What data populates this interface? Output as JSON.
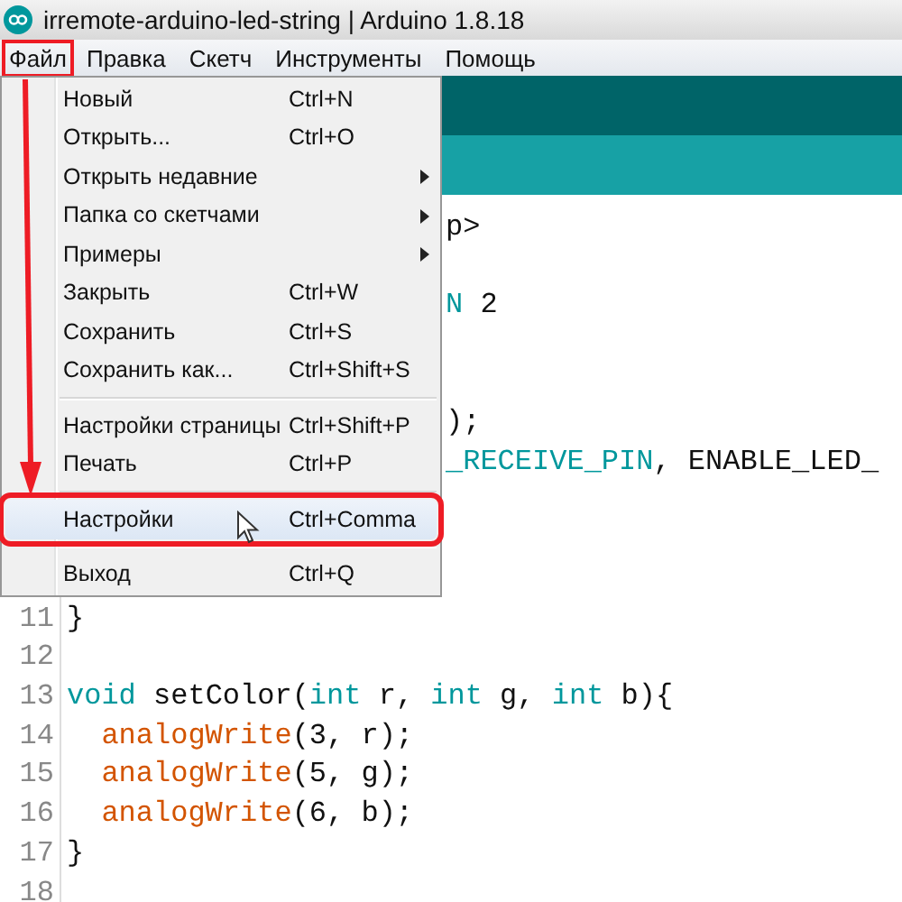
{
  "window": {
    "title": "irremote-arduino-led-string | Arduino 1.8.18"
  },
  "menubar": [
    {
      "label": "Файл",
      "selected": true
    },
    {
      "label": "Правка",
      "selected": false
    },
    {
      "label": "Скетч",
      "selected": false
    },
    {
      "label": "Инструменты",
      "selected": false
    },
    {
      "label": "Помощь",
      "selected": false
    }
  ],
  "file_menu": [
    {
      "kind": "item",
      "label": "Новый",
      "shortcut": "Ctrl+N",
      "submenu": false,
      "selected": false
    },
    {
      "kind": "item",
      "label": "Открыть...",
      "shortcut": "Ctrl+O",
      "submenu": false,
      "selected": false
    },
    {
      "kind": "item",
      "label": "Открыть недавние",
      "submenu": true,
      "selected": false
    },
    {
      "kind": "item",
      "label": "Папка со скетчами",
      "submenu": true,
      "selected": false
    },
    {
      "kind": "item",
      "label": "Примеры",
      "submenu": true,
      "selected": false
    },
    {
      "kind": "item",
      "label": "Закрыть",
      "shortcut": "Ctrl+W",
      "submenu": false,
      "selected": false
    },
    {
      "kind": "item",
      "label": "Сохранить",
      "shortcut": "Ctrl+S",
      "submenu": false,
      "selected": false
    },
    {
      "kind": "item",
      "label": "Сохранить как...",
      "shortcut": "Ctrl+Shift+S",
      "submenu": false,
      "selected": false
    },
    {
      "kind": "separator"
    },
    {
      "kind": "item",
      "label": "Настройки страницы",
      "shortcut": "Ctrl+Shift+P",
      "submenu": false,
      "selected": false
    },
    {
      "kind": "item",
      "label": "Печать",
      "shortcut": "Ctrl+P",
      "submenu": false,
      "selected": false
    },
    {
      "kind": "separator"
    },
    {
      "kind": "item",
      "label": "Настройки",
      "shortcut": "Ctrl+Comma",
      "submenu": false,
      "selected": true
    },
    {
      "kind": "separator"
    },
    {
      "kind": "item",
      "label": "Выход",
      "shortcut": "Ctrl+Q",
      "submenu": false,
      "selected": false
    }
  ],
  "editor": {
    "fragments_beside_menu": [
      {
        "segments": [
          {
            "kind": "plain",
            "text": "p>"
          }
        ]
      },
      {
        "segments": [
          {
            "kind": "constant",
            "text": "N"
          },
          {
            "kind": "plain",
            "text": " 2"
          }
        ]
      },
      {
        "segments": [
          {
            "kind": "plain",
            "text": ");"
          }
        ]
      },
      {
        "segments": [
          {
            "kind": "constant",
            "text": "_RECEIVE_PIN"
          },
          {
            "kind": "plain",
            "text": ", ENABLE_LED_"
          }
        ]
      }
    ],
    "lines": [
      {
        "number": "11",
        "segments": [
          {
            "kind": "plain",
            "text": "}"
          }
        ]
      },
      {
        "number": "12"
      },
      {
        "number": "13",
        "segments": [
          {
            "kind": "keyword",
            "text": "void"
          },
          {
            "kind": "plain",
            "text": " setColor("
          },
          {
            "kind": "keyword",
            "text": "int"
          },
          {
            "kind": "plain",
            "text": " r, "
          },
          {
            "kind": "keyword",
            "text": "int"
          },
          {
            "kind": "plain",
            "text": " g, "
          },
          {
            "kind": "keyword",
            "text": "int"
          },
          {
            "kind": "plain",
            "text": " b){"
          }
        ],
        "children": [
          {
            "number": "14",
            "segments": [
              {
                "kind": "function",
                "text": "analogWrite"
              },
              {
                "kind": "plain",
                "text": "(3, r);"
              }
            ]
          },
          {
            "number": "15",
            "segments": [
              {
                "kind": "function",
                "text": "analogWrite"
              },
              {
                "kind": "plain",
                "text": "(5, g);"
              }
            ]
          },
          {
            "number": "16",
            "segments": [
              {
                "kind": "function",
                "text": "analogWrite"
              },
              {
                "kind": "plain",
                "text": "(6, b);"
              }
            ]
          }
        ]
      },
      {
        "number": "17",
        "segments": [
          {
            "kind": "plain",
            "text": "}"
          }
        ]
      },
      {
        "number": "18"
      }
    ]
  }
}
